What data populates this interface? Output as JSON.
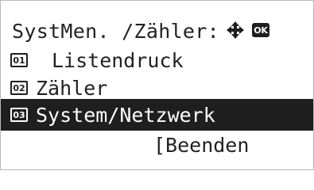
{
  "screen": {
    "title": "SystMen. /Zähler:",
    "nav_icon": "four-way-arrow-icon",
    "ok_label": "OK"
  },
  "menu": {
    "items": [
      {
        "number": "01",
        "label": "Listendruck",
        "selected": false
      },
      {
        "number": "02",
        "label": "Zähler",
        "selected": false
      },
      {
        "number": "03",
        "label": "System/Netzwerk",
        "selected": true
      }
    ]
  },
  "softkeys": {
    "right": "[Beenden"
  },
  "colors": {
    "highlight_bg": "#1f1f1f",
    "highlight_fg": "#ffffff",
    "text": "#222222"
  }
}
